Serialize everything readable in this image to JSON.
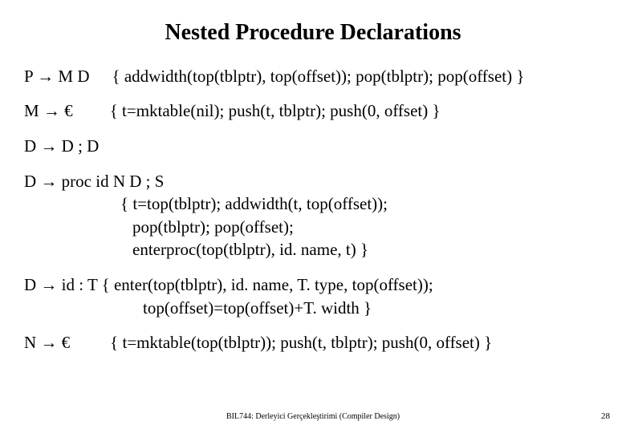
{
  "title": "Nested Procedure Declarations",
  "rules": {
    "r1_lhs": "P → M D",
    "r1_rhs": "{ addwidth(top(tblptr), top(offset)); pop(tblptr); pop(offset) }",
    "r2_lhs": "M → €",
    "r2_rhs": "{ t=mktable(nil); push(t, tblptr); push(0, offset) }",
    "r3": "D → D ; D",
    "r4_head": "D →  proc id N D ; S",
    "r4_line1": "{ t=top(tblptr); addwidth(t, top(offset));",
    "r4_line2": "pop(tblptr); pop(offset);",
    "r4_line3": "enterproc(top(tblptr), id. name, t) }",
    "r5_head": "D →  id : T { enter(top(tblptr), id. name, T. type, top(offset));",
    "r5_line1": "top(offset)=top(offset)+T. width }",
    "r6_lhs": "N → €",
    "r6_rhs": "{ t=mktable(top(tblptr)); push(t, tblptr); push(0, offset) }"
  },
  "footer": "BIL744: Derleyici Gerçekleştirimi (Compiler Design)",
  "pagenum": "28"
}
